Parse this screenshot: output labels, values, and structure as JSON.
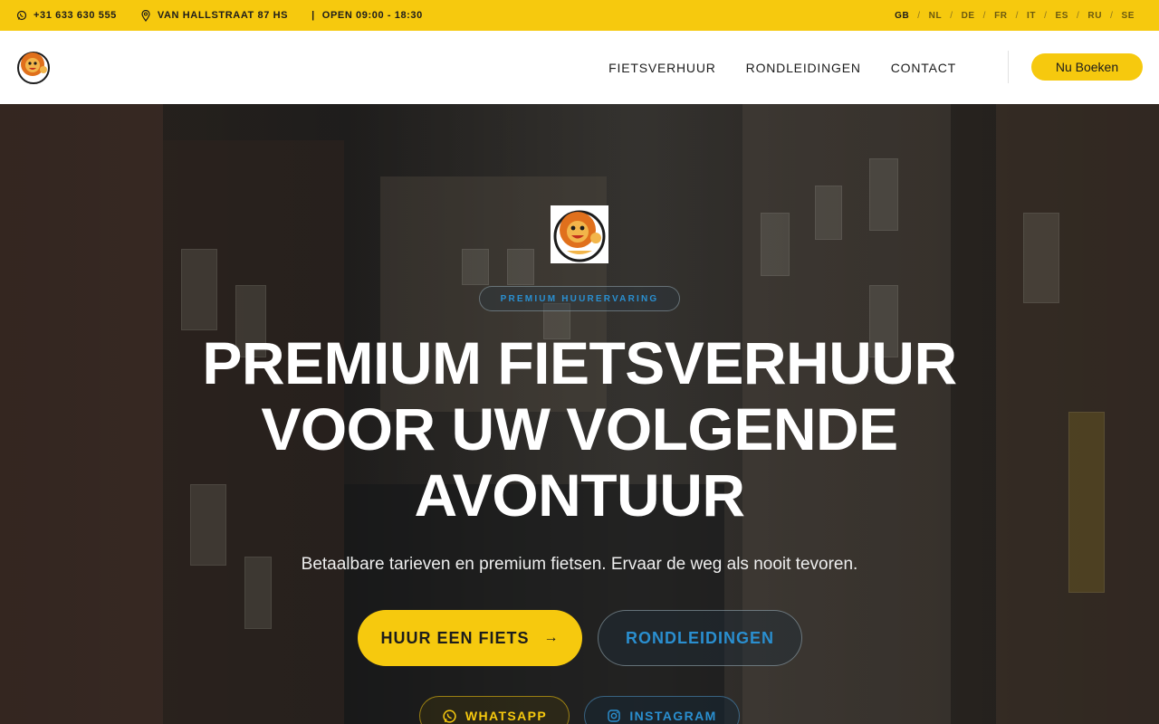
{
  "topbar": {
    "phone": "+31 633 630 555",
    "address": "VAN HALLSTRAAT 87 HS",
    "hours_sep": "|",
    "hours": "OPEN 09:00 - 18:30",
    "languages": [
      {
        "code": "GB",
        "active": true
      },
      {
        "code": "NL",
        "active": false
      },
      {
        "code": "DE",
        "active": false
      },
      {
        "code": "FR",
        "active": false
      },
      {
        "code": "IT",
        "active": false
      },
      {
        "code": "ES",
        "active": false
      },
      {
        "code": "RU",
        "active": false
      },
      {
        "code": "SE",
        "active": false
      }
    ],
    "lang_separator": "/"
  },
  "nav": {
    "links": [
      "FIETSVERHUUR",
      "RONDLEIDINGEN",
      "CONTACT"
    ],
    "book_label": "Nu Boeken"
  },
  "hero": {
    "badge": "PREMIUM HUURERVARING",
    "headline_line1": "PREMIUM FIETSVERHUUR",
    "headline_line2": "VOOR UW VOLGENDE",
    "headline_line3": "AVONTUUR",
    "subtitle": "Betaalbare tarieven en premium fietsen. Ervaar de weg als nooit tevoren.",
    "primary_button": "HUUR EEN FIETS",
    "primary_arrow": "→",
    "secondary_button": "RONDLEIDINGEN",
    "whatsapp_button": "WHATSAPP",
    "instagram_button": "INSTAGRAM"
  },
  "colors": {
    "accent": "#f6c90e",
    "link_blue": "#2a8fd0",
    "dark": "#1c1c1c"
  },
  "icons": {
    "phone": "whatsapp-icon",
    "address": "location-pin-icon",
    "logo": "lion-mascot-logo",
    "whatsapp": "whatsapp-icon",
    "instagram": "instagram-icon"
  }
}
